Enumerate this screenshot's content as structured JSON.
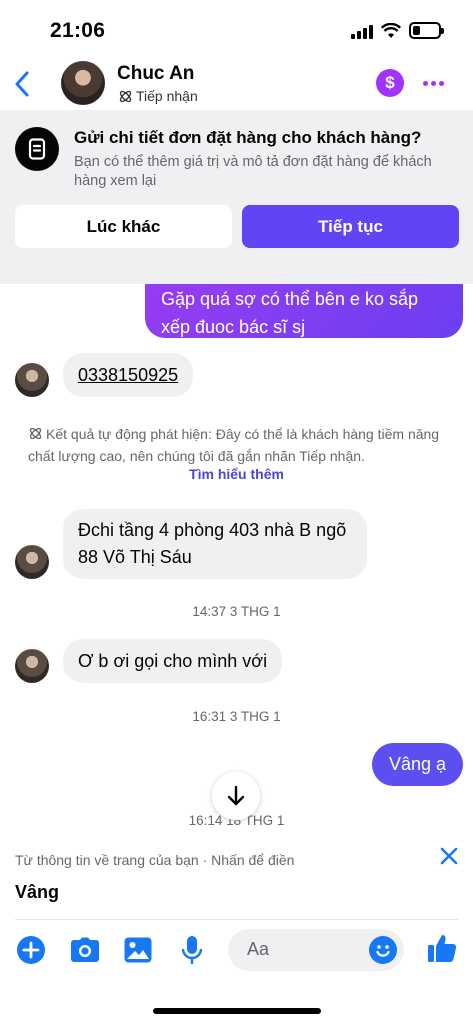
{
  "status_bar": {
    "time": "21:06"
  },
  "header": {
    "name": "Chuc An",
    "label": "Tiếp nhận",
    "pay_symbol": "$"
  },
  "order_banner": {
    "title": "Gửi chi tiết đơn đặt hàng cho khách hàng?",
    "description": "Bạn có thể thêm giá trị và mô tả đơn đặt hàng để khách hàng xem lại",
    "later_label": "Lúc khác",
    "continue_label": "Tiếp tục"
  },
  "messages": {
    "outgoing_cut": "Gặp quá sợ có thể bên e ko sắp xếp đuoc bác sĩ sj",
    "phone": "0338150925",
    "notice": "Kết quả tự động phát hiện: Đây có thể là khách hàng tiềm năng chất lượng cao, nên chúng tôi đã gắn nhãn Tiếp nhận.",
    "notice_link": "Tìm hiểu thêm",
    "address": "Đchi tầng 4 phòng 403 nhà B ngõ 88 Võ Thị Sáu",
    "time_1": "14:37 3 THG 1",
    "call_request": "Ơ b ơi gọi cho mình với",
    "time_2": "16:31 3 THG 1",
    "reply": "Vâng ạ",
    "time_3": "16:14 18 THG 1"
  },
  "suggestion": {
    "hint": "Từ thông tin về trang của bạn · Nhấn để điền",
    "text": "Vâng"
  },
  "composer": {
    "placeholder": "Aa"
  },
  "colors": {
    "accent": "#6344f5",
    "brand_blue": "#1877f2",
    "purple": "#a033ff"
  }
}
